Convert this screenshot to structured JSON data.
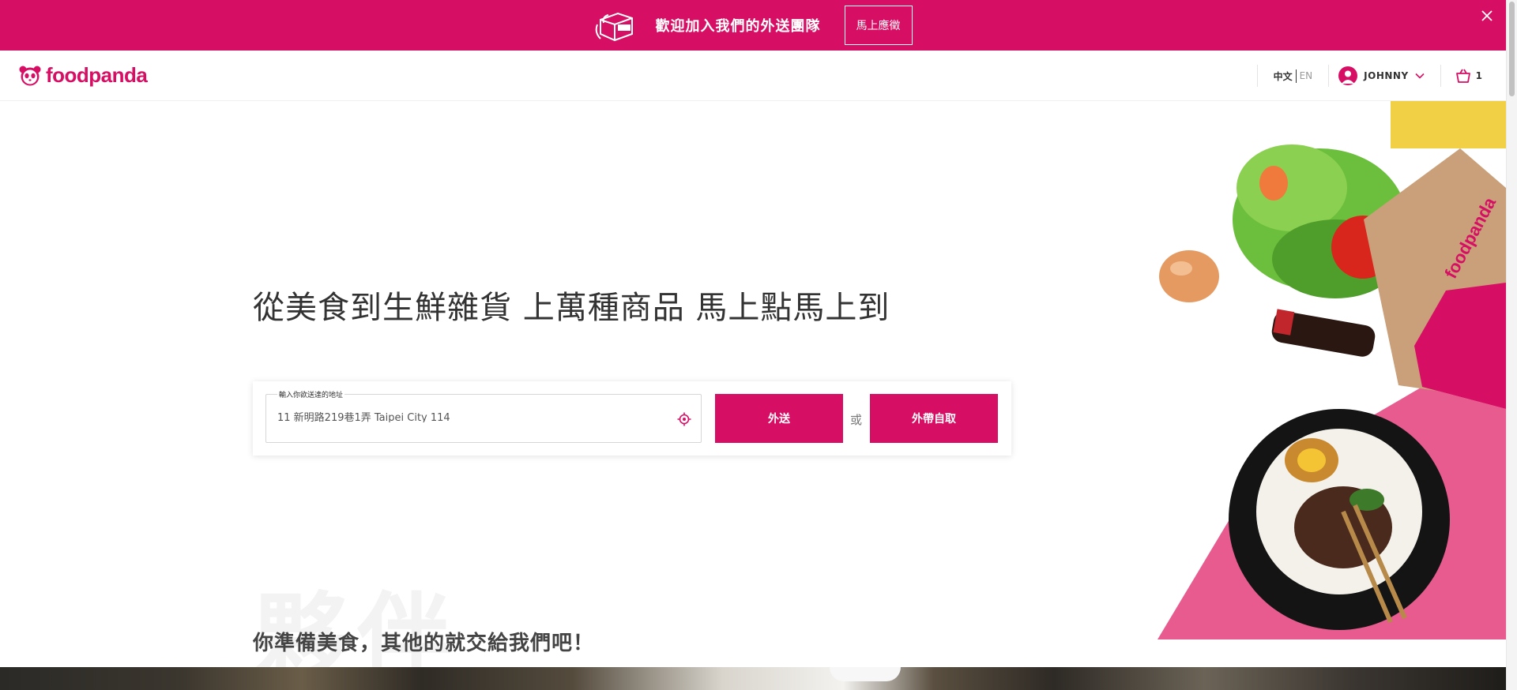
{
  "promo_banner": {
    "message": "歡迎加入我們的外送團隊",
    "cta_label": "馬上應徵",
    "background": "#d70f64"
  },
  "header": {
    "logo_text": "foodpanda",
    "languages": {
      "zh": "中文",
      "en": "EN"
    },
    "user_name": "JOHNNY",
    "cart_count": "1",
    "accent": "#d70f64"
  },
  "hero": {
    "title": "從美食到生鮮雜貨 上萬種商品 馬上點馬上到",
    "address_label": "輸入你欲送達的地址",
    "address_value": "11 新明路219巷1弄 Taipei City 114",
    "delivery_button": "外送",
    "or_text": "或",
    "pickup_button": "外帶自取",
    "bag_brand": "foodpanda"
  },
  "section": {
    "watermark": "夥伴",
    "subtitle": "你準備美食，其他的就交給我們吧！"
  }
}
